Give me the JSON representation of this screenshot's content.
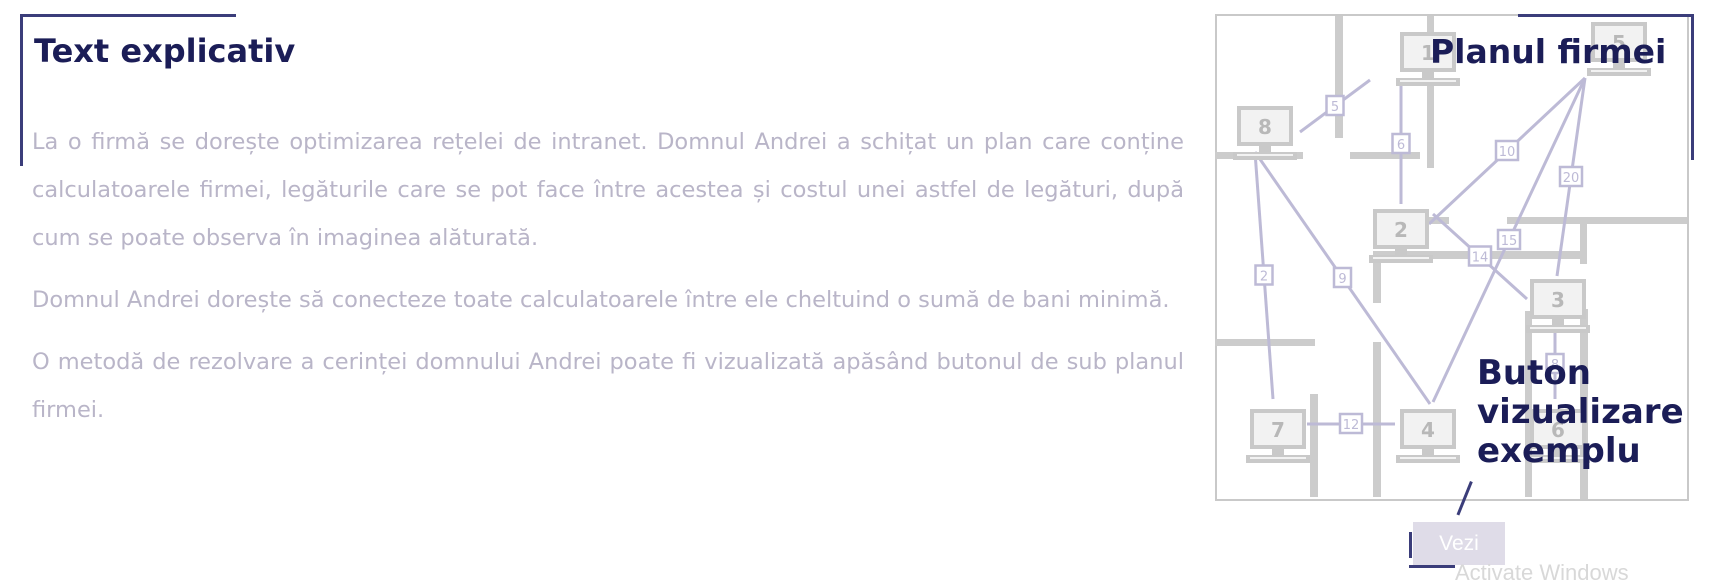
{
  "text_panel": {
    "title": "Text explicativ",
    "paragraphs": [
      "La o firmă se dorește optimizarea rețelei de intranet. Domnul Andrei a schițat un plan care conține calculatoarele firmei, legăturile care se pot face între acestea și costul unei astfel de legături, după cum se poate observa în imaginea alăturată.",
      "Domnul Andrei dorește să conecteze toate calculatoarele între ele cheltuind o sumă de bani minimă.",
      "O metodă de rezolvare a cerinței domnului Andrei poate fi vizualizată apăsând butonul de sub planul firmei."
    ]
  },
  "plan_panel": {
    "title": "Planul firmei",
    "callout_lines": [
      "Buton",
      "vizualizare",
      "exemplu"
    ],
    "button_label": "Vezi",
    "watermark": "Activate Windows"
  },
  "plan": {
    "computers": [
      {
        "label": "1"
      },
      {
        "label": "2"
      },
      {
        "label": "3"
      },
      {
        "label": "4"
      },
      {
        "label": "5"
      },
      {
        "label": "6"
      },
      {
        "label": "7"
      },
      {
        "label": "8"
      }
    ],
    "edges": [
      {
        "from": "8",
        "to": "1",
        "cost": "5"
      },
      {
        "from": "1",
        "to": "2",
        "cost": "6"
      },
      {
        "from": "5",
        "to": "2",
        "cost": "10"
      },
      {
        "from": "5",
        "to": "4",
        "cost": "15"
      },
      {
        "from": "5",
        "to": "3",
        "cost": "20"
      },
      {
        "from": "2",
        "to": "3",
        "cost": "14"
      },
      {
        "from": "8",
        "to": "7",
        "cost": "2"
      },
      {
        "from": "8",
        "to": "4",
        "cost": "9"
      },
      {
        "from": "7",
        "to": "4",
        "cost": "12"
      },
      {
        "from": "3",
        "to": "6",
        "cost": "8"
      }
    ]
  },
  "colors": {
    "heading": "#1b1d57",
    "body_text": "#b9b5c8",
    "accent_bracket": "#3b3d7a",
    "edge": "#bdbad6",
    "computer": "#c9c9c9",
    "button_bg": "#dfdce8"
  }
}
